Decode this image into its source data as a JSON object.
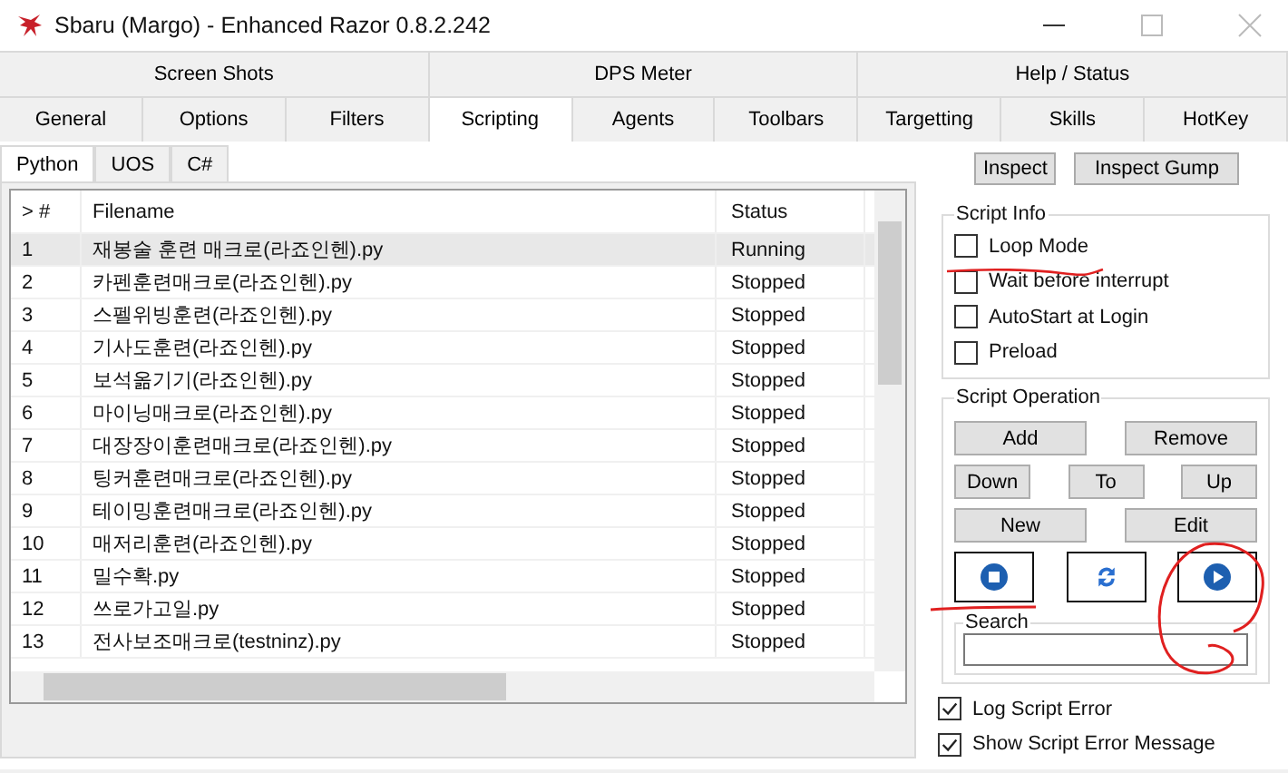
{
  "window": {
    "title": "Sbaru (Margo) - Enhanced Razor 0.8.2.242"
  },
  "tab_rows": [
    [
      {
        "label": "Screen Shots",
        "selected": false
      },
      {
        "label": "DPS Meter",
        "selected": false
      },
      {
        "label": "Help / Status",
        "selected": false
      }
    ],
    [
      {
        "label": "General",
        "selected": false
      },
      {
        "label": "Options",
        "selected": false
      },
      {
        "label": "Filters",
        "selected": false
      },
      {
        "label": "Scripting",
        "selected": true
      },
      {
        "label": "Agents",
        "selected": false
      },
      {
        "label": "Toolbars",
        "selected": false
      },
      {
        "label": "Targetting",
        "selected": false
      },
      {
        "label": "Skills",
        "selected": false
      },
      {
        "label": "HotKey",
        "selected": false
      }
    ]
  ],
  "sub_tabs": [
    {
      "label": "Python",
      "selected": true
    },
    {
      "label": "UOS",
      "selected": false
    },
    {
      "label": "C#",
      "selected": false
    }
  ],
  "table": {
    "columns": [
      "> #",
      "Filename",
      "Status"
    ],
    "rows": [
      {
        "num": "1",
        "filename": "재봉술 훈련 매크로(라죠인헨).py",
        "status": "Running",
        "selected": true
      },
      {
        "num": "2",
        "filename": "카펜훈련매크로(라죠인헨).py",
        "status": "Stopped",
        "selected": false
      },
      {
        "num": "3",
        "filename": "스펠위빙훈련(라죠인헨).py",
        "status": "Stopped",
        "selected": false
      },
      {
        "num": "4",
        "filename": "기사도훈련(라죠인헨).py",
        "status": "Stopped",
        "selected": false
      },
      {
        "num": "5",
        "filename": "보석옮기기(라죠인헨).py",
        "status": "Stopped",
        "selected": false
      },
      {
        "num": "6",
        "filename": "마이닝매크로(라죠인헨).py",
        "status": "Stopped",
        "selected": false
      },
      {
        "num": "7",
        "filename": "대장장이훈련매크로(라죠인헨).py",
        "status": "Stopped",
        "selected": false
      },
      {
        "num": "8",
        "filename": "팅커훈련매크로(라죠인헨).py",
        "status": "Stopped",
        "selected": false
      },
      {
        "num": "9",
        "filename": "테이밍훈련매크로(라죠인헨).py",
        "status": "Stopped",
        "selected": false
      },
      {
        "num": "10",
        "filename": "매저리훈련(라죠인헨).py",
        "status": "Stopped",
        "selected": false
      },
      {
        "num": "11",
        "filename": "밀수확.py",
        "status": "Stopped",
        "selected": false
      },
      {
        "num": "12",
        "filename": "쓰로가고일.py",
        "status": "Stopped",
        "selected": false
      },
      {
        "num": "13",
        "filename": "전사보조매크로(testninz).py",
        "status": "Stopped",
        "selected": false
      }
    ]
  },
  "inspect_buttons": [
    "Inspect",
    "Inspect Gump"
  ],
  "script_info": {
    "title": "Script Info",
    "options": [
      {
        "label": "Loop Mode",
        "checked": false
      },
      {
        "label": "Wait before interrupt",
        "checked": false
      },
      {
        "label": "AutoStart at Login",
        "checked": false
      },
      {
        "label": "Preload",
        "checked": false
      }
    ]
  },
  "script_operation": {
    "title": "Script Operation",
    "rows": [
      [
        "Add",
        "Remove"
      ],
      [
        "Down",
        "To",
        "Up"
      ],
      [
        "New",
        "Edit"
      ]
    ],
    "icon_buttons": [
      {
        "kind": "stop"
      },
      {
        "kind": "refresh"
      },
      {
        "kind": "play"
      }
    ]
  },
  "search": {
    "label": "Search"
  },
  "bottom_options": [
    {
      "label": "Log Script Error",
      "checked": true
    },
    {
      "label": "Show Script Error Message",
      "checked": true
    }
  ]
}
